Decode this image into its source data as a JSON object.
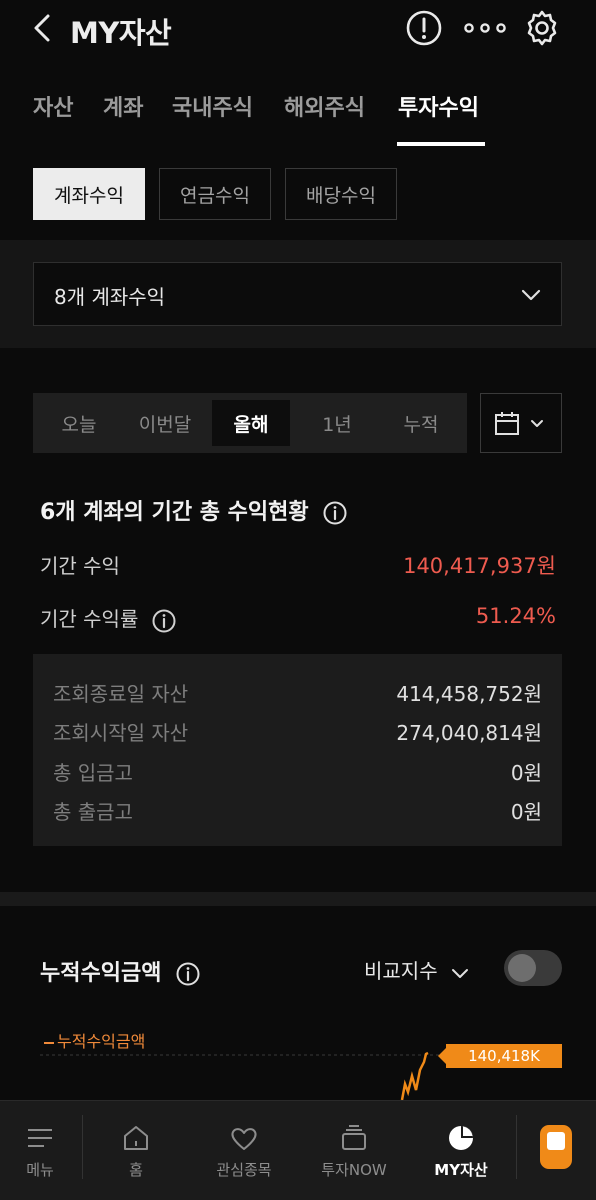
{
  "header": {
    "title": "MY자산"
  },
  "tabs": [
    {
      "label": "자산"
    },
    {
      "label": "계좌"
    },
    {
      "label": "국내주식"
    },
    {
      "label": "해외주식"
    },
    {
      "label": "투자수익"
    }
  ],
  "subtabs": [
    {
      "label": "계좌수익"
    },
    {
      "label": "연금수익"
    },
    {
      "label": "배당수익"
    }
  ],
  "account_select": {
    "value": "8개 계좌수익"
  },
  "periods": [
    {
      "label": "오늘"
    },
    {
      "label": "이번달"
    },
    {
      "label": "올해"
    },
    {
      "label": "1년"
    },
    {
      "label": "누적"
    }
  ],
  "summary": {
    "title": "6개 계좌의 기간 총 수익현황",
    "profit_label": "기간 수익",
    "profit_value": "140,417,937원",
    "rate_label": "기간 수익률",
    "rate_value": "51.24%"
  },
  "details": [
    {
      "label": "조회종료일 자산",
      "value": "414,458,752원"
    },
    {
      "label": "조회시작일 자산",
      "value": "274,040,814원"
    },
    {
      "label": "총 입금고",
      "value": "0원"
    },
    {
      "label": "총 출금고",
      "value": "0원"
    }
  ],
  "cumulative": {
    "title": "누적수익금액",
    "compare_label": "비교지수",
    "legend": "누적수익금액",
    "badge": "140,418K"
  },
  "colors": {
    "accent_red": "#ee5b4f",
    "accent_orange": "#f08a18"
  },
  "bottom_nav": [
    {
      "label": "메뉴",
      "icon": "menu-icon"
    },
    {
      "label": "홈",
      "icon": "home-icon"
    },
    {
      "label": "관심종목",
      "icon": "heart-icon"
    },
    {
      "label": "투자NOW",
      "icon": "layers-icon"
    },
    {
      "label": "MY자산",
      "icon": "pie-chart-icon"
    }
  ]
}
